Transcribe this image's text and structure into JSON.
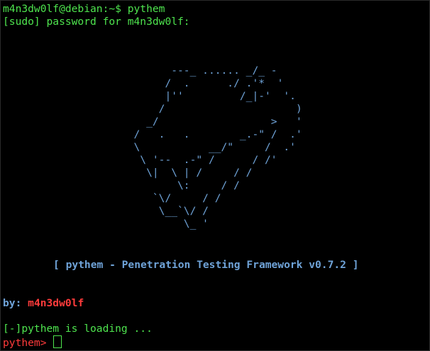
{
  "terminal": {
    "prompt_line": "m4n3dw0lf@debian:~$ pythem",
    "sudo_line": "[sudo] password for m4n3dw0lf:",
    "ascii_art": [
      "                           ---_ ...... _/_ -",
      "                          /  .      ./ .'*  '",
      "                          |''         /_|-'  '.",
      "                         /                     )",
      "                       _/                  >   '",
      "                     /   .   .        _.-\" /  .'",
      "                     \\           __/\"     /  .'",
      "                      \\ '--  .-\" /      / /'",
      "                       \\|  \\ | /     / /",
      "                            \\:     / /",
      "                        `\\/     / /",
      "                         \\__`\\/ /",
      "                             \\_ '"
    ],
    "banner": "[ pythem - Penetration Testing Framework v0.7.2 ]",
    "by_label": "by:",
    "author": "m4n3dw0lf",
    "loading_line": "[-]pythem is loading ...",
    "input_prompt": "pythem>"
  },
  "colors": {
    "background": "#000000",
    "prompt_green": "#4ee44e",
    "art_blue": "#6fa3d8",
    "author_red": "#ff3b3b"
  }
}
